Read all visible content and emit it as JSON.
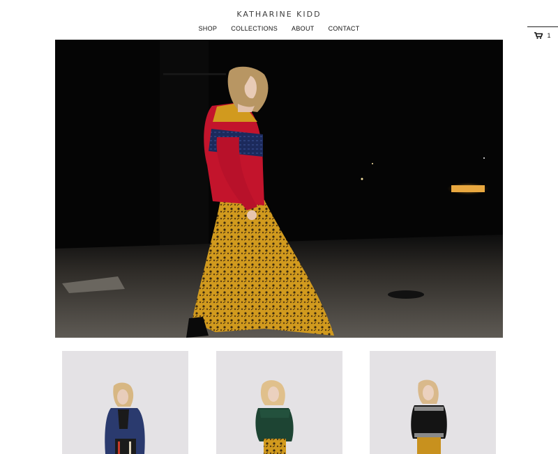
{
  "header": {
    "brand": "KATHARINE KIDD",
    "nav": [
      "SHOP",
      "COLLECTIONS",
      "ABOUT",
      "CONTACT"
    ]
  },
  "cart": {
    "icon": "cart-icon",
    "count": "1"
  },
  "hero": {
    "image": "model in red and navy sweater and yellow printed maxi skirt walking at night",
    "colors": {
      "sweater_red": "#c3142c",
      "sweater_navy": "#1c2a5c",
      "skirt_mustard": "#d19a1e"
    }
  },
  "products": [
    {
      "image": "model in navy bomber jacket"
    },
    {
      "image": "model in green ruffle sweater"
    },
    {
      "image": "model in black sheer top"
    }
  ]
}
